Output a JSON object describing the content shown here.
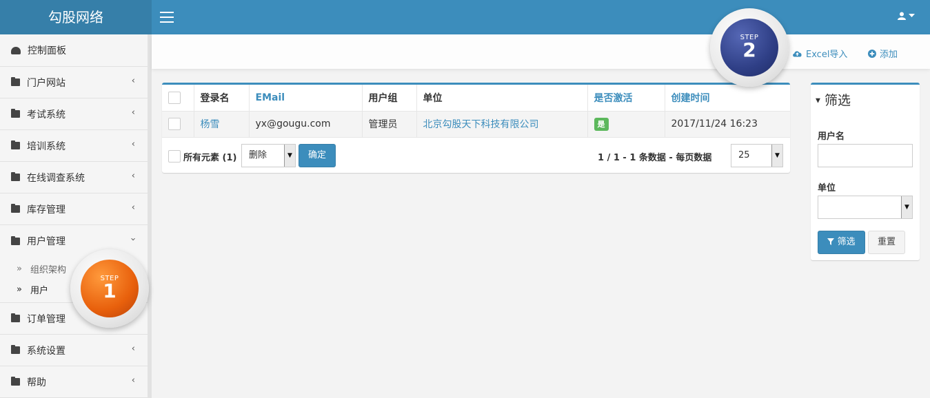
{
  "header": {
    "brand": "勾股网络",
    "import_label": "Excel导入",
    "add_label": "添加"
  },
  "sidebar": {
    "items": [
      {
        "label": "控制面板"
      },
      {
        "label": "门户网站"
      },
      {
        "label": "考试系统"
      },
      {
        "label": "培训系统"
      },
      {
        "label": "在线调查系统"
      },
      {
        "label": "库存管理"
      },
      {
        "label": "用户管理"
      },
      {
        "label": "订单管理"
      },
      {
        "label": "系统设置"
      },
      {
        "label": "帮助"
      }
    ],
    "sub_items": [
      {
        "label": "组织架构"
      },
      {
        "label": "用户"
      }
    ]
  },
  "table": {
    "headers": [
      "登录名",
      "EMail",
      "用户组",
      "单位",
      "是否激活",
      "创建时间"
    ],
    "rows": [
      {
        "login": "杨雪",
        "email": "yx@gougu.com",
        "group": "管理员",
        "unit": "北京勾股天下科技有限公司",
        "active": "是",
        "created": "2017/11/24 16:23"
      }
    ],
    "footer": {
      "all_label": "所有元素 (1)",
      "action_value": "删除",
      "confirm_label": "确定",
      "page_info": "1 / 1 - 1 条数据 - 每页数据",
      "page_size": "25"
    }
  },
  "filter": {
    "title": "筛选",
    "username_label": "用户名",
    "unit_label": "单位",
    "filter_button": "筛选",
    "reset_button": "重置"
  },
  "steps": {
    "step_word": "STEP",
    "one": "1",
    "two": "2"
  },
  "colors": {
    "primary": "#3c8dbc",
    "brand_bg": "#367fa9",
    "success": "#5cb85c",
    "step1": "#e8600c",
    "step2": "#2f3f86"
  }
}
